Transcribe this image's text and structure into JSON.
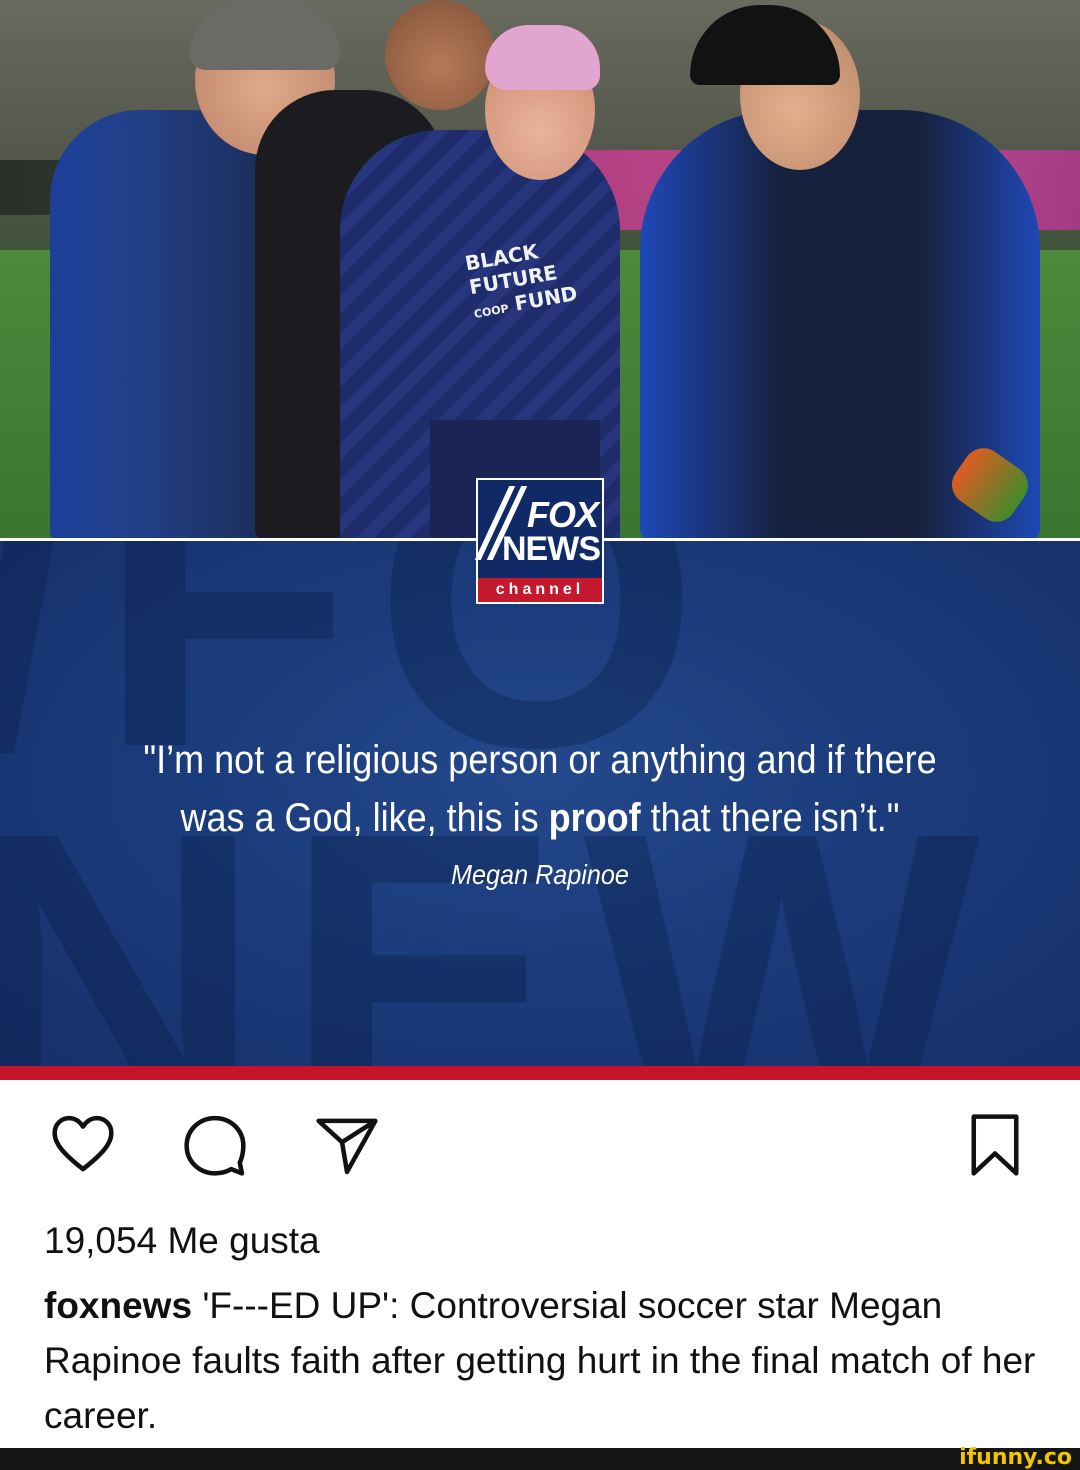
{
  "image": {
    "jersey_text": [
      "BLACK",
      "FUTURE",
      "CO",
      "OP",
      "FUND"
    ],
    "logo": {
      "line1": "FOX",
      "line2": "NEWS",
      "line3": "channel"
    }
  },
  "quote": {
    "line1": "\"I’m not a religious person or anything and if there",
    "line2_pre": "was a God, like, this is ",
    "line2_bold": "proof",
    "line2_post": " that there isn’t.\"",
    "author": "Megan Rapinoe"
  },
  "actions": {
    "icons": [
      "heart-icon",
      "comment-icon",
      "share-icon",
      "bookmark-icon"
    ]
  },
  "post": {
    "likes": "19,054 Me gusta",
    "username": "foxnews",
    "caption": " 'F---ED UP': Controversial soccer star Megan Rapinoe faults faith after getting hurt in the final match of her career."
  },
  "watermark": "ifunny.co",
  "colors": {
    "brand_blue": "#1b3c7c",
    "brand_red": "#c5142a",
    "watermark_yellow": "#f2c500"
  }
}
